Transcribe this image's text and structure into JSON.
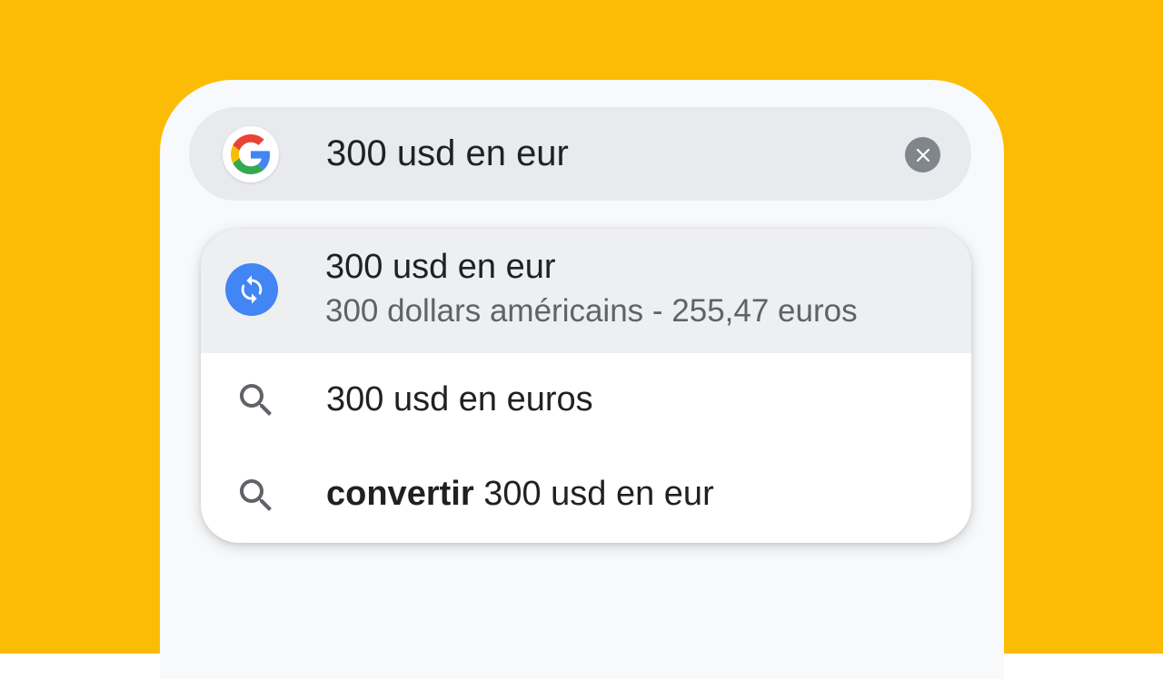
{
  "theme": {
    "background": "#FCBC05",
    "panel": "#F8F9FA",
    "search_bar": "#E8EAED",
    "highlight_row": "#EEEFF1",
    "accent_blue": "#4285F4",
    "clear_button": "#80868B"
  },
  "search": {
    "logo_icon": "google-g-icon",
    "value": "300 usd en eur",
    "clear_icon": "close-icon"
  },
  "suggestions": [
    {
      "icon": "currency-convert-icon",
      "title": "300 usd en eur",
      "subtitle": "300 dollars américains - 255,47 euros"
    },
    {
      "icon": "search-icon",
      "text": "300 usd en euros"
    },
    {
      "icon": "search-icon",
      "bold": "convertir",
      "text": "300 usd en eur"
    }
  ]
}
